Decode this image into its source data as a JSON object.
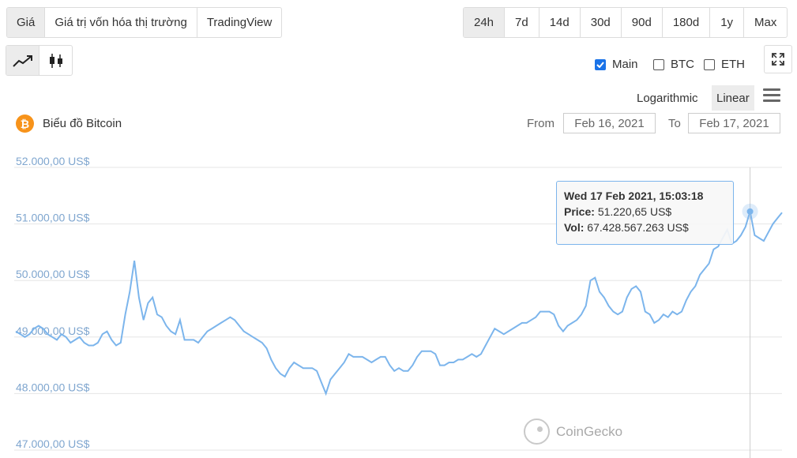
{
  "tabs": [
    {
      "label": "Giá",
      "active": true
    },
    {
      "label": "Giá trị vốn hóa thị trường",
      "active": false
    },
    {
      "label": "TradingView",
      "active": false
    }
  ],
  "ranges": [
    {
      "label": "24h",
      "active": true
    },
    {
      "label": "7d",
      "active": false
    },
    {
      "label": "14d",
      "active": false
    },
    {
      "label": "30d",
      "active": false
    },
    {
      "label": "90d",
      "active": false
    },
    {
      "label": "180d",
      "active": false
    },
    {
      "label": "1y",
      "active": false
    },
    {
      "label": "Max",
      "active": false
    }
  ],
  "chart_types": [
    {
      "icon": "line-chart-icon",
      "active": true
    },
    {
      "icon": "candlestick-icon",
      "active": false
    }
  ],
  "overlays": [
    {
      "label": "Main",
      "checked": true
    },
    {
      "label": "BTC",
      "checked": false
    },
    {
      "label": "ETH",
      "checked": false
    }
  ],
  "scale": {
    "logarithmic_label": "Logarithmic",
    "linear_label": "Linear",
    "active": "Linear"
  },
  "title": "Biểu đồ Bitcoin",
  "date_range": {
    "from_label": "From",
    "from_value": "Feb 16, 2021",
    "to_label": "To",
    "to_value": "Feb 17, 2021"
  },
  "tooltip": {
    "datetime": "Wed 17 Feb 2021, 15:03:18",
    "price_label": "Price:",
    "price_value": "51.220,65 US$",
    "vol_label": "Vol:",
    "vol_value": "67.428.567.263 US$"
  },
  "watermark": "CoinGecko",
  "colors": {
    "line": "#7cb5ec",
    "accent": "#1a73e8",
    "bitcoin": "#f7931a"
  },
  "chart_data": {
    "type": "line",
    "title": "Biểu đồ Bitcoin",
    "y_ticks": [
      "52.000,00 US$",
      "51.000,00 US$",
      "50.000,00 US$",
      "49.000,00 US$",
      "48.000,00 US$",
      "47.000,00 US$"
    ],
    "ylim": [
      47000,
      52000
    ],
    "grid": true,
    "legend": "none",
    "series": [
      {
        "values": [
          49100,
          49050,
          49000,
          49050,
          49150,
          49200,
          49150,
          49050,
          49000,
          48950,
          49050,
          49000,
          48900,
          48950,
          49000,
          48900,
          48850,
          48850,
          48900,
          49050,
          49100,
          48950,
          48850,
          48900,
          49400,
          49800,
          50350,
          49700,
          49300,
          49600,
          49700,
          49400,
          49350,
          49200,
          49100,
          49050,
          49300,
          48950,
          48950,
          48950,
          48900,
          49000,
          49100,
          49150,
          49200,
          49250,
          49300,
          49350,
          49300,
          49200,
          49100,
          49050,
          49000,
          48950,
          48900,
          48800,
          48600,
          48450,
          48350,
          48300,
          48450,
          48550,
          48500,
          48450,
          48450,
          48450,
          48400,
          48200,
          48000,
          48250,
          48350,
          48450,
          48550,
          48700,
          48650,
          48650,
          48650,
          48600,
          48550,
          48600,
          48650,
          48650,
          48500,
          48400,
          48450,
          48400,
          48400,
          48500,
          48650,
          48750,
          48750,
          48750,
          48700,
          48500,
          48500,
          48550,
          48550,
          48600,
          48600,
          48650,
          48700,
          48650,
          48700,
          48850,
          49000,
          49150,
          49100,
          49050,
          49100,
          49150,
          49200,
          49250,
          49250,
          49300,
          49350,
          49450,
          49450,
          49450,
          49400,
          49200,
          49100,
          49200,
          49250,
          49300,
          49400,
          49550,
          50000,
          50050,
          49800,
          49700,
          49550,
          49450,
          49400,
          49450,
          49700,
          49850,
          49900,
          49800,
          49450,
          49400,
          49250,
          49300,
          49400,
          49350,
          49450,
          49400,
          49450,
          49650,
          49800,
          49900,
          50100,
          50200,
          50300,
          50550,
          50600,
          50750,
          50900,
          50650,
          50700,
          50800,
          50950,
          51220,
          50800,
          50750,
          50700,
          50850,
          51000,
          51100,
          51200
        ]
      }
    ]
  }
}
